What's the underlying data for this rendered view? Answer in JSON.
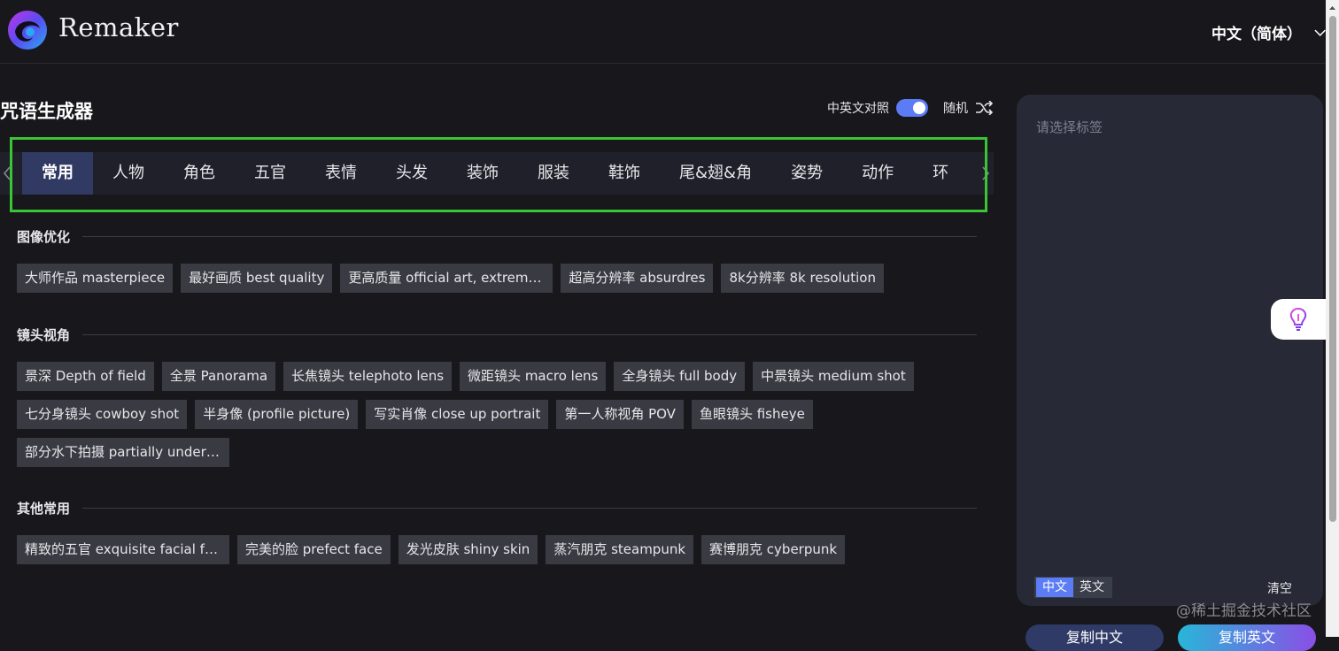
{
  "header": {
    "brand": "Remaker",
    "language": "中文（简体）"
  },
  "page": {
    "title": "咒语生成器",
    "bilingual_label": "中英文对照",
    "bilingual_enabled": true,
    "random_label": "随机"
  },
  "tabs": [
    "常用",
    "人物",
    "角色",
    "五官",
    "表情",
    "头发",
    "装饰",
    "服装",
    "鞋饰",
    "尾&翅&角",
    "姿势",
    "动作",
    "环"
  ],
  "active_tab": "常用",
  "sections": [
    {
      "title": "图像优化",
      "chips": [
        "大师作品 masterpiece",
        "最好画质 best quality",
        "更高质量 official art, extremel…",
        "超高分辨率 absurdres",
        "8k分辨率 8k resolution"
      ]
    },
    {
      "title": "镜头视角",
      "chips": [
        "景深 Depth of field",
        "全景 Panorama",
        "长焦镜头 telephoto lens",
        "微距镜头 macro lens",
        "全身镜头 full body",
        "中景镜头 medium shot",
        "七分身镜头 cowboy shot",
        "半身像 (profile picture)",
        "写实肖像 close up portrait",
        "第一人称视角 POV",
        "鱼眼镜头 fisheye",
        "部分水下拍摄 partially underw…"
      ]
    },
    {
      "title": "其他常用",
      "chips": [
        "精致的五官 exquisite facial fe…",
        "完美的脸 prefect face",
        "发光皮肤 shiny skin",
        "蒸汽朋克 steampunk",
        "赛博朋克 cyberpunk"
      ]
    }
  ],
  "panel": {
    "placeholder": "请选择标签",
    "lang_tabs": [
      "中文",
      "英文"
    ],
    "active_lang": "中文",
    "clear_label": "清空",
    "copy_cn": "复制中文",
    "copy_en": "复制英文"
  },
  "watermark": "@稀土掘金技术社区",
  "colors": {
    "background": "#17171c",
    "accent": "#5b7cf5",
    "highlight": "#3ac436",
    "chip": "#3a3b42",
    "panel": "#272a36"
  }
}
